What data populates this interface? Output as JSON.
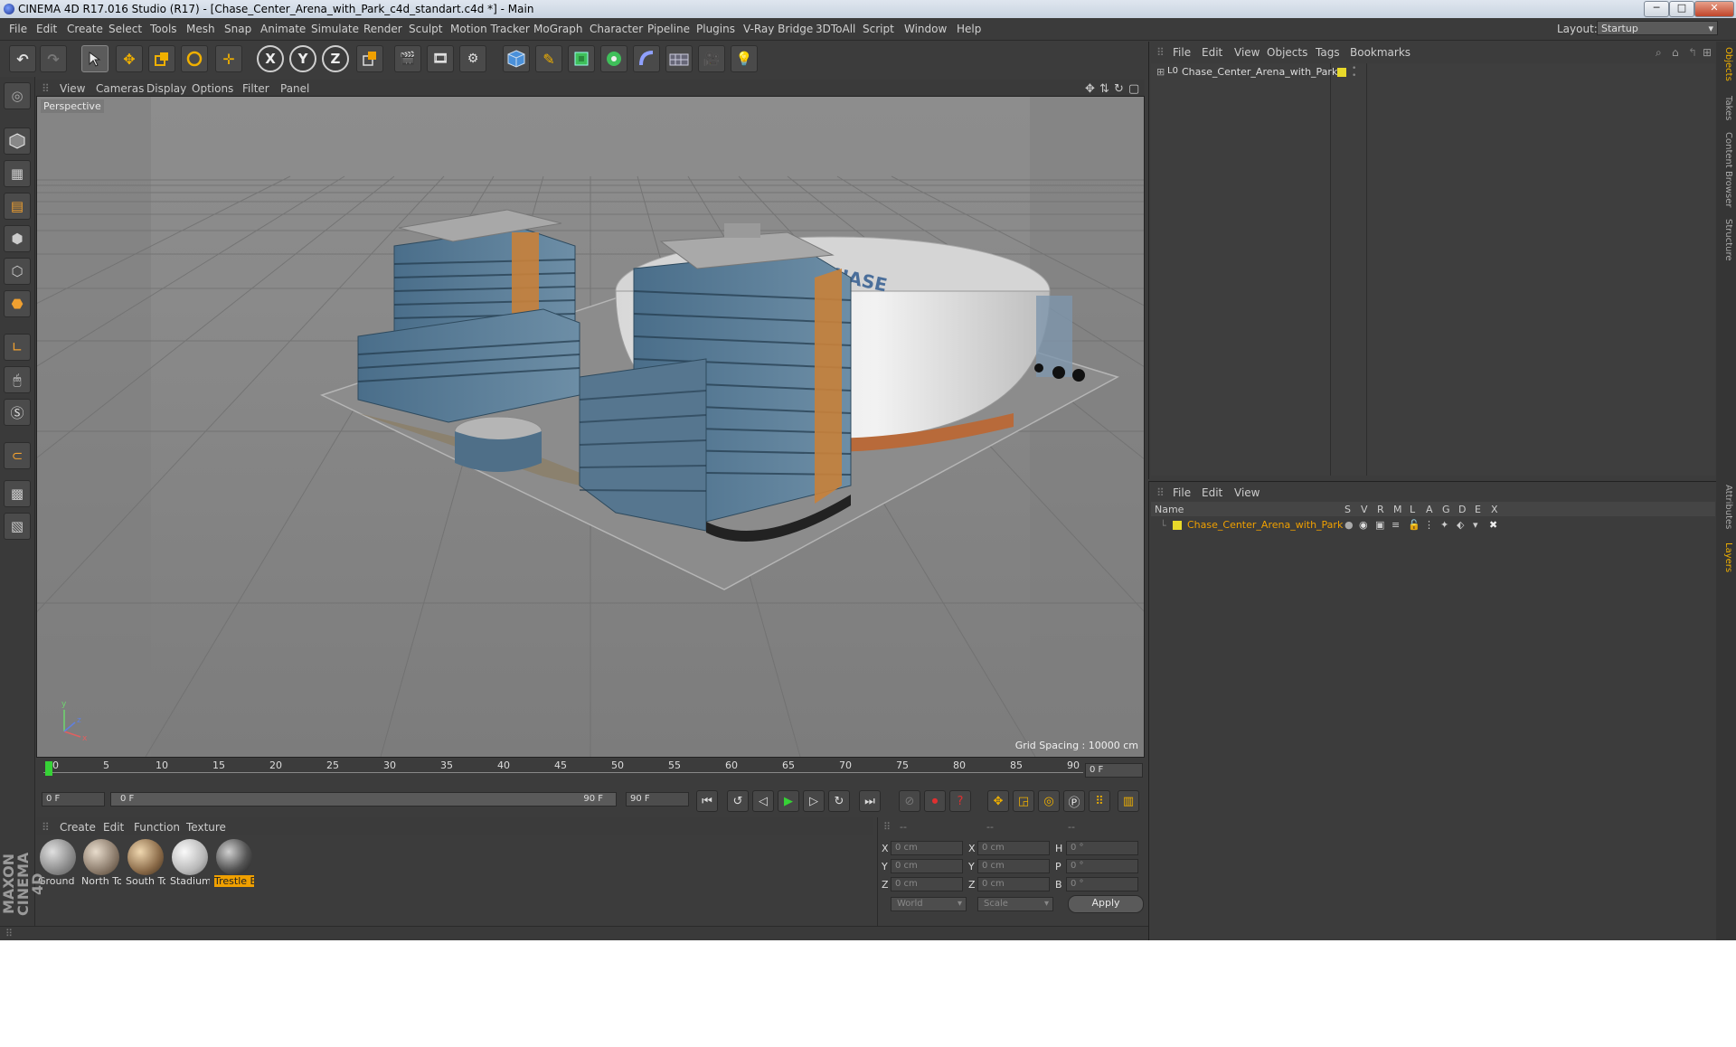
{
  "window": {
    "title": "CINEMA 4D R17.016 Studio (R17) - [Chase_Center_Arena_with_Park_c4d_standart.c4d *] - Main",
    "minimize": "─",
    "maximize": "□",
    "close": "✕"
  },
  "menubar": {
    "items": [
      "File",
      "Edit",
      "Create",
      "Select",
      "Tools",
      "Mesh",
      "Snap",
      "Animate",
      "Simulate",
      "Render",
      "Sculpt",
      "Motion Tracker",
      "MoGraph",
      "Character",
      "Pipeline",
      "Plugins",
      "V-Ray Bridge",
      "3DToAll",
      "Script",
      "Window",
      "Help"
    ],
    "layout_label": "Layout:",
    "layout_value": "Startup"
  },
  "toolbar": {
    "undo": "↶",
    "redo": "↷",
    "axis_x": "X",
    "axis_y": "Y",
    "axis_z": "Z"
  },
  "viewport": {
    "menu": [
      "View",
      "Cameras",
      "Display",
      "Options",
      "Filter",
      "Panel"
    ],
    "label": "Perspective",
    "grid_spacing": "Grid Spacing : 10000 cm",
    "axis_x": "x",
    "axis_y": "y",
    "axis_z": "z"
  },
  "timeline": {
    "ticks": [
      "0",
      "5",
      "10",
      "15",
      "20",
      "25",
      "30",
      "35",
      "40",
      "45",
      "50",
      "55",
      "60",
      "65",
      "70",
      "75",
      "80",
      "85",
      "90"
    ],
    "current_frame": "0 F",
    "start_field": "0 F",
    "range_start": "0 F",
    "range_end": "90 F",
    "end_field": "90 F"
  },
  "materials": {
    "menu": [
      "Create",
      "Edit",
      "Function",
      "Texture"
    ],
    "items": [
      {
        "label": "Ground",
        "color": "#9a9a9a"
      },
      {
        "label": "North To",
        "color": "#8a7a6a"
      },
      {
        "label": "South To",
        "color": "#7a6a58"
      },
      {
        "label": "Stadium",
        "color": "#b8b8b8"
      },
      {
        "label": "Trestle E",
        "color": "#555555"
      }
    ]
  },
  "coordinates": {
    "header": [
      "--",
      "--",
      "--"
    ],
    "rows": [
      {
        "a": "X",
        "av": "0 cm",
        "b": "X",
        "bv": "0 cm",
        "c": "H",
        "cv": "0 °"
      },
      {
        "a": "Y",
        "av": "0 cm",
        "b": "Y",
        "bv": "0 cm",
        "c": "P",
        "cv": "0 °"
      },
      {
        "a": "Z",
        "av": "0 cm",
        "b": "Z",
        "bv": "0 cm",
        "c": "B",
        "cv": "0 °"
      }
    ],
    "world": "World",
    "scale": "Scale",
    "apply": "Apply"
  },
  "objects_panel": {
    "menu": [
      "File",
      "Edit",
      "View",
      "Objects",
      "Tags",
      "Bookmarks"
    ],
    "object_name": "Chase_Center_Arena_with_Park",
    "swatch_color": "#e8d92a"
  },
  "layers_panel": {
    "menu": [
      "File",
      "Edit",
      "View"
    ],
    "columns": [
      "Name",
      "S",
      "V",
      "R",
      "M",
      "L",
      "A",
      "G",
      "D",
      "E",
      "X"
    ],
    "layer_name": "Chase_Center_Arena_with_Park",
    "layer_name_color": "#f0a000"
  },
  "side_tabs": [
    "Objects",
    "Takes",
    "Content Browser",
    "Structure",
    "Attributes",
    "Layers"
  ],
  "brand": "MAXON CINEMA 4D"
}
